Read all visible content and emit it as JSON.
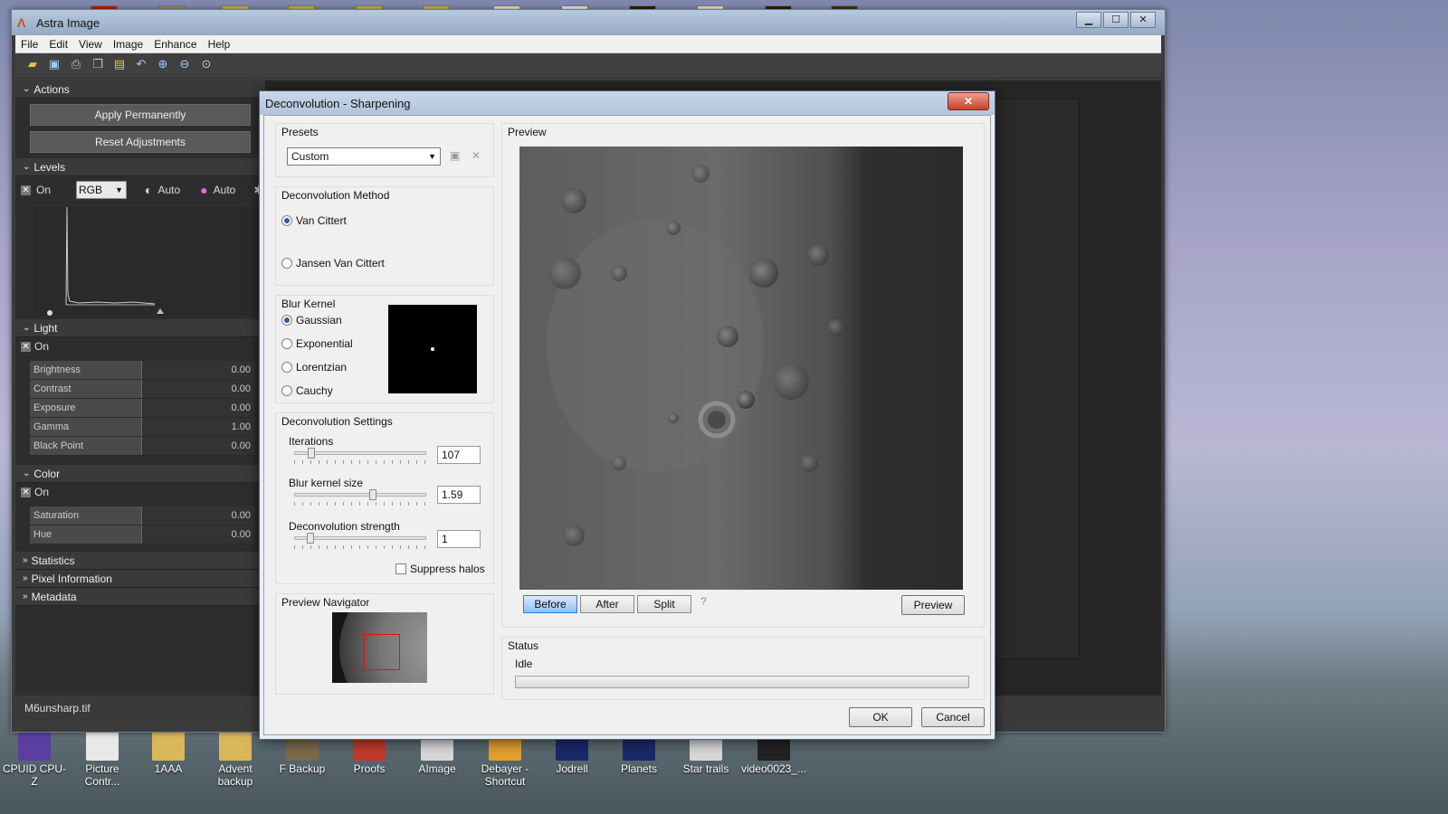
{
  "main_window": {
    "title": "Astra Image",
    "menu": [
      "File",
      "Edit",
      "View",
      "Image",
      "Enhance",
      "Help"
    ],
    "status_file": "M6unsharp.tif"
  },
  "left_panel": {
    "actions": {
      "header": "Actions",
      "apply_label": "Apply Permanently",
      "reset_label": "Reset Adjustments"
    },
    "levels": {
      "header": "Levels",
      "on_label": "On",
      "channel": "RGB",
      "auto1": "Auto",
      "auto2": "Auto"
    },
    "light": {
      "header": "Light",
      "on_label": "On",
      "rows": [
        {
          "name": "Brightness",
          "value": "0.00"
        },
        {
          "name": "Contrast",
          "value": "0.00"
        },
        {
          "name": "Exposure",
          "value": "0.00"
        },
        {
          "name": "Gamma",
          "value": "1.00"
        },
        {
          "name": "Black Point",
          "value": "0.00"
        }
      ]
    },
    "color": {
      "header": "Color",
      "on_label": "On",
      "rows": [
        {
          "name": "Saturation",
          "value": "0.00"
        },
        {
          "name": "Hue",
          "value": "0.00"
        }
      ]
    },
    "collapsed": [
      "Statistics",
      "Pixel Information",
      "Metadata"
    ]
  },
  "dialog": {
    "title": "Deconvolution - Sharpening",
    "close": "✕",
    "presets": {
      "title": "Presets",
      "value": "Custom"
    },
    "method": {
      "title": "Deconvolution Method",
      "options": [
        "Van Cittert",
        "Jansen Van Cittert"
      ],
      "selected": 0
    },
    "kernel": {
      "title": "Blur Kernel",
      "options": [
        "Gaussian",
        "Exponential",
        "Lorentzian",
        "Cauchy"
      ],
      "selected": 0
    },
    "settings": {
      "title": "Deconvolution Settings",
      "iterations_label": "Iterations",
      "iterations_value": "107",
      "blur_label": "Blur kernel size",
      "blur_value": "1.59",
      "strength_label": "Deconvolution strength",
      "strength_value": "1",
      "suppress_label": "Suppress halos"
    },
    "navigator": {
      "title": "Preview Navigator"
    },
    "preview": {
      "title": "Preview",
      "before": "Before",
      "after": "After",
      "split": "Split",
      "help": "?",
      "preview_button": "Preview"
    },
    "status": {
      "title": "Status",
      "text": "Idle"
    },
    "ok": "OK",
    "cancel": "Cancel"
  },
  "desktop_icons": [
    {
      "label": "CPUID CPU-Z",
      "color": "#5b3fa0"
    },
    {
      "label": "Picture Contr...",
      "color": "#e8e8e8"
    },
    {
      "label": "1AAA",
      "color": "#d9b85a"
    },
    {
      "label": "Advent backup",
      "color": "#d9b85a"
    },
    {
      "label": "F Backup",
      "color": "#7a6a4a"
    },
    {
      "label": "Proofs",
      "color": "#c0392b"
    },
    {
      "label": "AImage",
      "color": "#d8d8d8"
    },
    {
      "label": "Debayer - Shortcut",
      "color": "#e0a030"
    },
    {
      "label": "Jodrell",
      "color": "#1a2a6a"
    },
    {
      "label": "Planets",
      "color": "#1a2a6a"
    },
    {
      "label": "Star trails",
      "color": "#d8d8d8"
    },
    {
      "label": "video0023_...",
      "color": "#222222"
    }
  ]
}
